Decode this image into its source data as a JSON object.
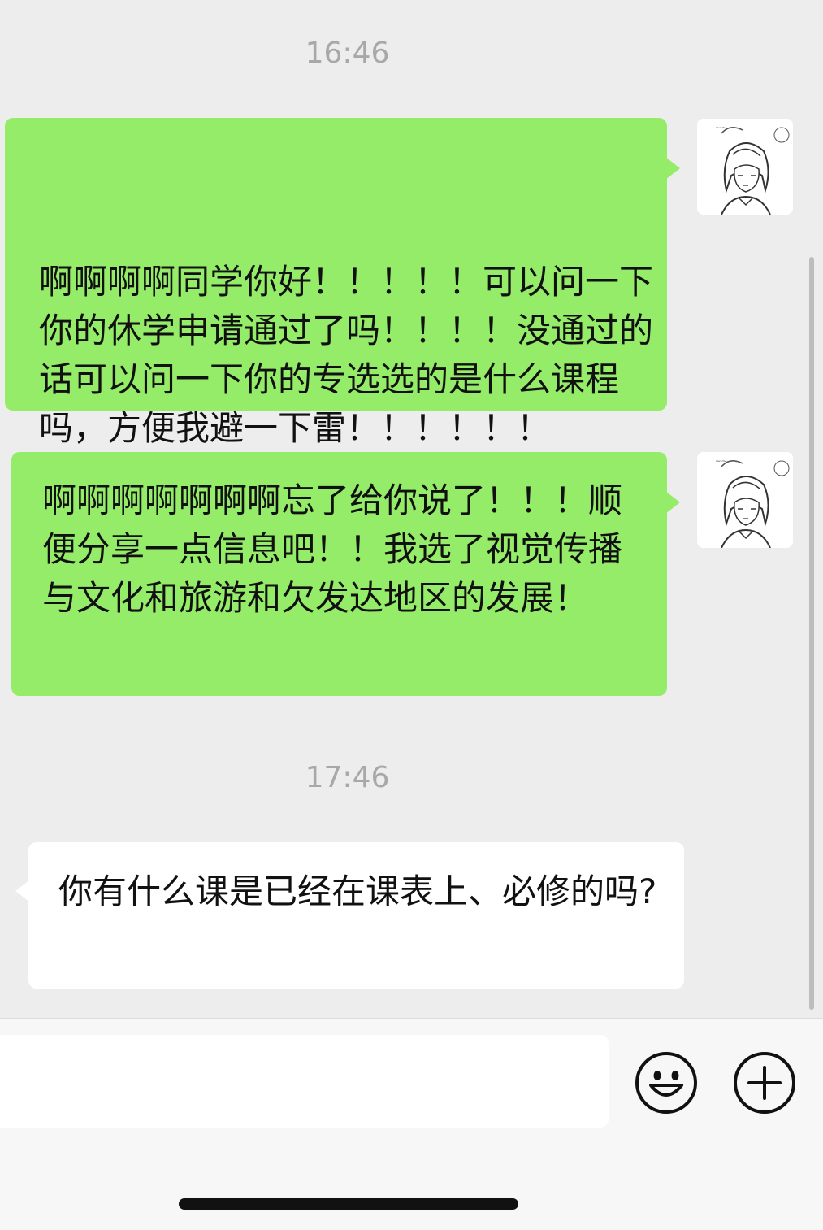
{
  "chat": {
    "timestamps": [
      "16:46",
      "17:46"
    ],
    "messages": [
      {
        "direction": "outgoing",
        "text": "啊啊啊啊同学你好！！！！！可以问一下你的休学申请通过了吗！！！！没通过的话可以问一下你的专选选的是什么课程吗，方便我避一下雷！！！！！！"
      },
      {
        "direction": "outgoing",
        "text": "啊啊啊啊啊啊啊忘了给你说了！！！顺便分享一点信息吧！！我选了视觉传播与文化和旅游和欠发达地区的发展！"
      },
      {
        "direction": "incoming",
        "text": "你有什么课是已经在课表上、必修的吗?"
      }
    ]
  },
  "avatar": {
    "icon": "user-avatar-sketch-girl",
    "colors": {
      "bg": "#ffffff",
      "stroke": "#333333"
    }
  },
  "input_bar": {
    "value": "",
    "icons": [
      "emoji-icon",
      "plus-icon"
    ]
  },
  "colors": {
    "outgoing_bubble": "#95ec69",
    "incoming_bubble": "#ffffff",
    "background": "#ededed",
    "timestamp": "#a8a8a8"
  }
}
